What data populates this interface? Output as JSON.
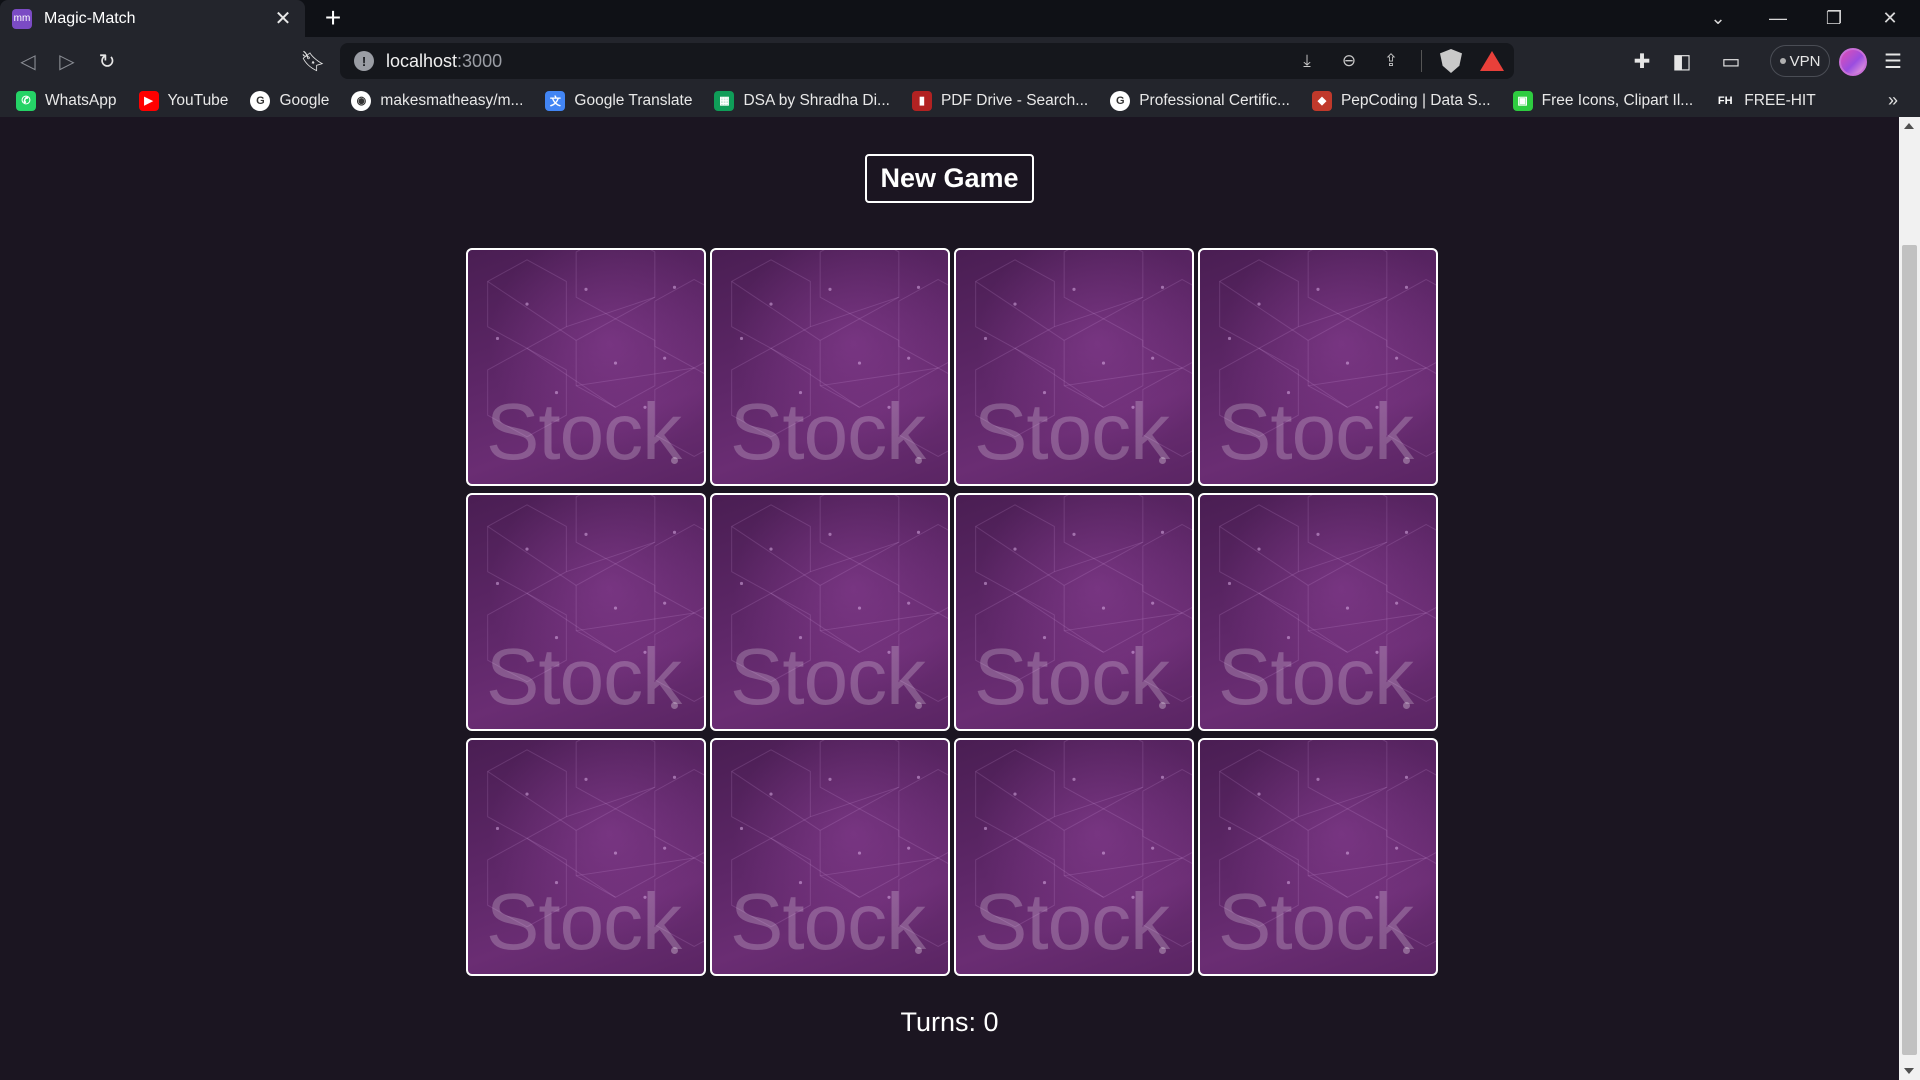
{
  "browser": {
    "tab_title": "Magic-Match",
    "tab_favicon_text": "mm",
    "url_host": "localhost",
    "url_port": ":3000",
    "vpn_label": "VPN",
    "bookmarks": [
      {
        "label": "WhatsApp",
        "icon": "whatsapp-icon",
        "color": "#25d366",
        "glyph": "✆"
      },
      {
        "label": "YouTube",
        "icon": "youtube-icon",
        "color": "#ff0000",
        "glyph": "▶"
      },
      {
        "label": "Google",
        "icon": "google-icon",
        "color": "#ffffff",
        "glyph": "G"
      },
      {
        "label": "makesmatheasy/m...",
        "icon": "github-icon",
        "color": "#ffffff",
        "glyph": "◉"
      },
      {
        "label": "Google Translate",
        "icon": "google-translate-icon",
        "color": "#4285f4",
        "glyph": "文"
      },
      {
        "label": "DSA by Shradha Di...",
        "icon": "sheets-icon",
        "color": "#0f9d58",
        "glyph": "▦"
      },
      {
        "label": "PDF Drive - Search...",
        "icon": "pdf-drive-icon",
        "color": "#b22222",
        "glyph": "▮"
      },
      {
        "label": "Professional Certific...",
        "icon": "google-icon",
        "color": "#ffffff",
        "glyph": "G"
      },
      {
        "label": "PepCoding | Data S...",
        "icon": "pepcoding-icon",
        "color": "#c0392b",
        "glyph": "◆"
      },
      {
        "label": "Free Icons, Clipart Il...",
        "icon": "freeicons-icon",
        "color": "#2ecc40",
        "glyph": "▣"
      },
      {
        "label": "FREE-HIT",
        "icon": "freehit-icon",
        "color": "#23252c",
        "glyph": "FH"
      }
    ],
    "bookmarks_more": "»"
  },
  "game": {
    "new_game_label": "New Game",
    "card_back_watermark": "Stock",
    "card_count": 12,
    "turns_text": "Turns: 0"
  }
}
